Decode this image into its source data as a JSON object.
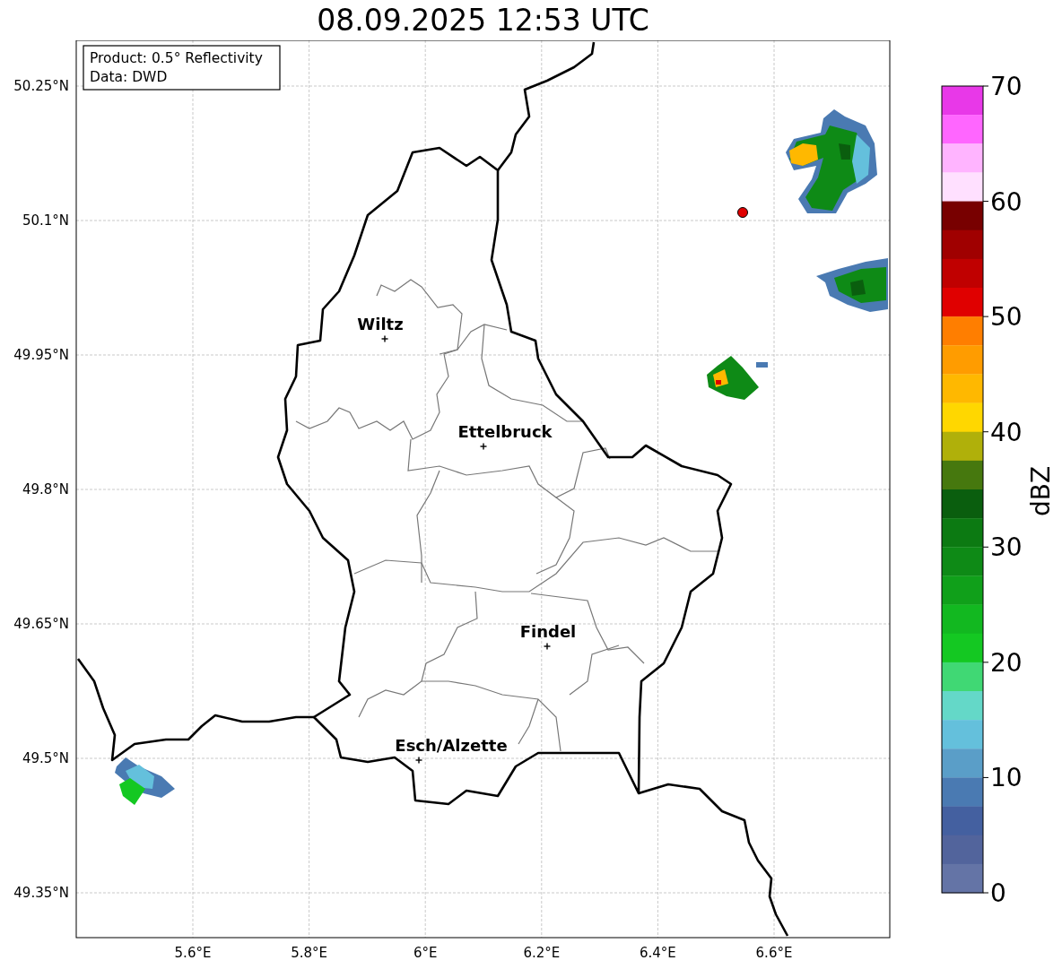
{
  "title": "08.09.2025 12:53 UTC",
  "info_box": [
    "Product: 0.5° Reflectivity",
    "Data: DWD"
  ],
  "map": {
    "lat_ticks": [
      "50.25°N",
      "50.1°N",
      "49.95°N",
      "49.8°N",
      "49.65°N",
      "49.5°N",
      "49.35°N"
    ],
    "lon_ticks": [
      "5.6°E",
      "5.8°E",
      "6°E",
      "6.2°E",
      "6.4°E",
      "6.6°E"
    ],
    "cities": [
      {
        "name": "Wiltz"
      },
      {
        "name": "Ettelbruck"
      },
      {
        "name": "Findel"
      },
      {
        "name": "Esch/Alzette"
      }
    ]
  },
  "colorbar": {
    "label": "dBZ",
    "ticks": [
      "70",
      "60",
      "50",
      "40",
      "30",
      "20",
      "10",
      "0"
    ],
    "segments": [
      {
        "color": "#e838e8"
      },
      {
        "color": "#ff66ff"
      },
      {
        "color": "#ffb4ff"
      },
      {
        "color": "#ffe0ff"
      },
      {
        "color": "#780000"
      },
      {
        "color": "#a00000"
      },
      {
        "color": "#c00000"
      },
      {
        "color": "#e00000"
      },
      {
        "color": "#ff7e00"
      },
      {
        "color": "#ff9c00"
      },
      {
        "color": "#ffb800"
      },
      {
        "color": "#ffd700"
      },
      {
        "color": "#b0b00a"
      },
      {
        "color": "#46780e"
      },
      {
        "color": "#0a5e0e"
      },
      {
        "color": "#0c7a12"
      },
      {
        "color": "#0e8a16"
      },
      {
        "color": "#10a01a"
      },
      {
        "color": "#12b820"
      },
      {
        "color": "#14c822"
      },
      {
        "color": "#40d874"
      },
      {
        "color": "#64d8c8"
      },
      {
        "color": "#64c0dc"
      },
      {
        "color": "#5a9ec8"
      },
      {
        "color": "#4a7ab2"
      },
      {
        "color": "#4460a0"
      },
      {
        "color": "#52649c"
      },
      {
        "color": "#6474a6"
      }
    ]
  }
}
